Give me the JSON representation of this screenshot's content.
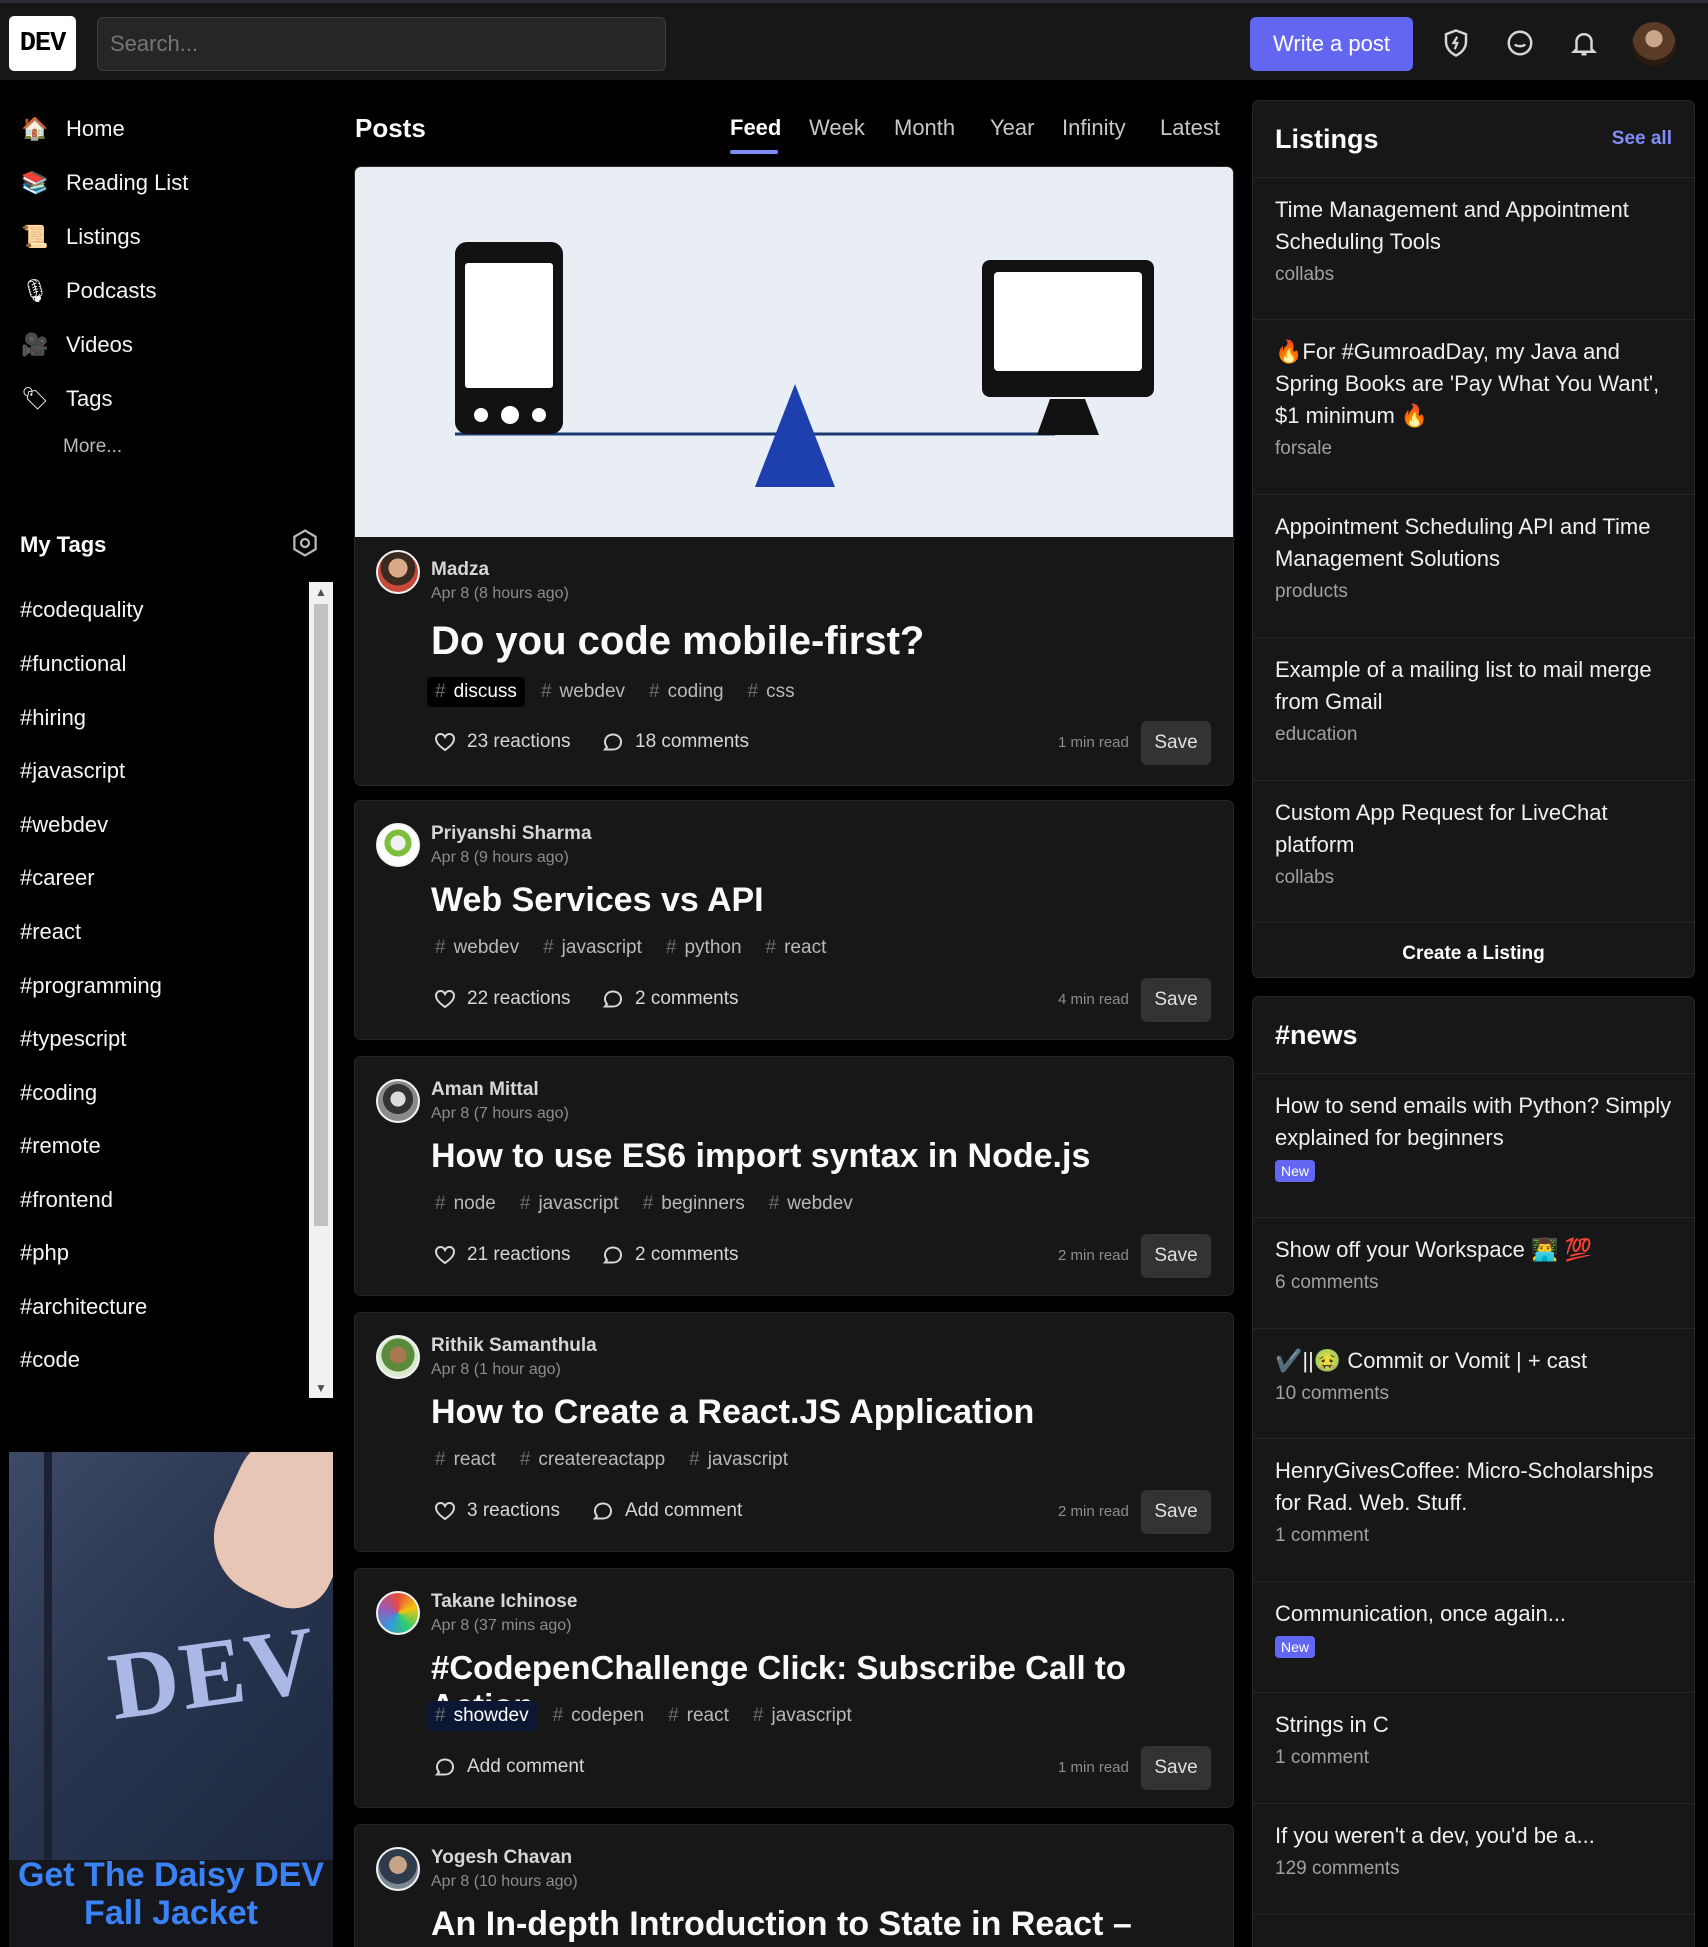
{
  "header": {
    "logo": "DEV",
    "search_placeholder": "Search...",
    "write_post": "Write a post"
  },
  "sidebar": {
    "nav": [
      {
        "label": "Home",
        "icon": "house-icon"
      },
      {
        "label": "Reading List",
        "icon": "reading-list-icon"
      },
      {
        "label": "Listings",
        "icon": "scroll-icon"
      },
      {
        "label": "Podcasts",
        "icon": "microphone-icon"
      },
      {
        "label": "Videos",
        "icon": "video-camera-icon"
      },
      {
        "label": "Tags",
        "icon": "tag-icon"
      }
    ],
    "more": "More...",
    "my_tags_title": "My Tags",
    "tags": [
      "#codequality",
      "#functional",
      "#hiring",
      "#javascript",
      "#webdev",
      "#career",
      "#react",
      "#programming",
      "#typescript",
      "#coding",
      "#remote",
      "#frontend",
      "#php",
      "#architecture",
      "#code"
    ],
    "ad_text_line1": "Get The Daisy DEV",
    "ad_text_line2": "Fall Jacket",
    "ad_image_text": "DEV"
  },
  "feed": {
    "title": "Posts",
    "tabs": [
      "Feed",
      "Week",
      "Month",
      "Year",
      "Infinity",
      "Latest"
    ],
    "active_tab": "Feed",
    "save_label": "Save",
    "posts": [
      {
        "author": "Madza",
        "date": "Apr 8 (8 hours ago)",
        "title": "Do you code mobile-first?",
        "tags": [
          "discuss",
          "webdev",
          "coding",
          "css"
        ],
        "reactions": "23 reactions",
        "comments": "18 comments",
        "read_time": "1 min read"
      },
      {
        "author": "Priyanshi Sharma",
        "date": "Apr 8 (9 hours ago)",
        "title": "Web Services vs API",
        "tags": [
          "webdev",
          "javascript",
          "python",
          "react"
        ],
        "reactions": "22 reactions",
        "comments": "2 comments",
        "read_time": "4 min read"
      },
      {
        "author": "Aman Mittal",
        "date": "Apr 8 (7 hours ago)",
        "title": "How to use ES6 import syntax in Node.js",
        "tags": [
          "node",
          "javascript",
          "beginners",
          "webdev"
        ],
        "reactions": "21 reactions",
        "comments": "2 comments",
        "read_time": "2 min read"
      },
      {
        "author": "Rithik Samanthula",
        "date": "Apr 8 (1 hour ago)",
        "title": "How to Create a React.JS Application",
        "tags": [
          "react",
          "createreactapp",
          "javascript"
        ],
        "reactions": "3 reactions",
        "comments": "Add comment",
        "read_time": "2 min read"
      },
      {
        "author": "Takane Ichinose",
        "date": "Apr 8 (37 mins ago)",
        "title": "#CodepenChallenge Click: Subscribe Call to Action",
        "tags": [
          "showdev",
          "codepen",
          "react",
          "javascript"
        ],
        "reactions": "",
        "comments": "Add comment",
        "read_time": "1 min read"
      },
      {
        "author": "Yogesh Chavan",
        "date": "Apr 8 (10 hours ago)",
        "title": "An In-depth Introduction to State in React –"
      }
    ]
  },
  "listings": {
    "title": "Listings",
    "see_all": "See all",
    "items": [
      {
        "title": "Time Management and Appointment Scheduling Tools",
        "category": "collabs"
      },
      {
        "title": "🔥For #GumroadDay, my Java and Spring Books are 'Pay What You Want', $1 minimum 🔥",
        "category": "forsale"
      },
      {
        "title": "Appointment Scheduling API and Time Management Solutions",
        "category": "products"
      },
      {
        "title": "Example of a mailing list to mail merge from Gmail",
        "category": "education"
      },
      {
        "title": "Custom App Request for LiveChat platform",
        "category": "collabs"
      }
    ],
    "create": "Create a Listing"
  },
  "news": {
    "title": "#news",
    "items": [
      {
        "title": "How to send emails with Python? Simply explained for beginners",
        "sub": "",
        "badge": "New"
      },
      {
        "title": "Show off your Workspace 👨‍💻 💯",
        "sub": "6 comments",
        "badge": ""
      },
      {
        "title": "✔️||🤢 Commit or Vomit | + cast",
        "sub": "10 comments",
        "badge": ""
      },
      {
        "title": "HenryGivesCoffee: Micro-Scholarships for Rad. Web. Stuff.",
        "sub": "1 comment",
        "badge": ""
      },
      {
        "title": "Communication, once again...",
        "sub": "",
        "badge": "New"
      },
      {
        "title": "Strings in C",
        "sub": "1 comment",
        "badge": ""
      },
      {
        "title": "If you weren't a dev, you'd be a...",
        "sub": "129 comments",
        "badge": ""
      }
    ]
  },
  "colors": {
    "accent": "#6366f1",
    "background": "#000000",
    "card": "#171717"
  }
}
